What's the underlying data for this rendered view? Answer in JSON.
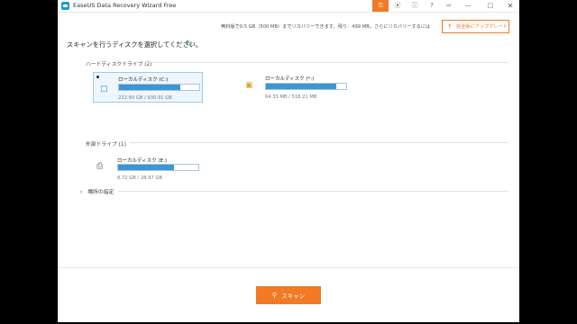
{
  "window": {
    "title": "EaseUS Data Recovery Wizard Free"
  },
  "titlebar": {
    "icons": [
      "key-icon",
      "share-icon",
      "info-icon",
      "help-icon",
      "exit-icon",
      "minimize-icon",
      "maximize-icon",
      "close-icon"
    ]
  },
  "trial": {
    "text": "無料版で0.5 GB（500 MB）までリカバリーできます。残り：499 MB。さらにリカバリーするには"
  },
  "upgrade": {
    "label": "完全版にアップグレード"
  },
  "heading": "スキャンを行うディスクを選択してください。",
  "hard_disk_section": {
    "label": "ハードディスクドライブ (2)",
    "drives": [
      {
        "name": "ローカルディスク (C:)",
        "size": "222.90 GB / 930.91 GB",
        "used_fraction": 0.76,
        "selected": true
      },
      {
        "name": "ローカルディスク (*:)",
        "size": "64.33 MB / 518.21 MB",
        "used_fraction": 0.88,
        "selected": false
      }
    ]
  },
  "external_section": {
    "label": "外部ドライブ (1)",
    "drives": [
      {
        "name": "ローカルディスク (E:)",
        "size": "8.72 GB / 28.97 GB",
        "used_fraction": 0.7
      }
    ]
  },
  "locate": {
    "label": "場所の指定"
  },
  "scan_button": {
    "label": "スキャン"
  },
  "colors": {
    "accent": "#f07a25",
    "bar_fill": "#3a97d4",
    "refresh": "#2a9d64"
  }
}
